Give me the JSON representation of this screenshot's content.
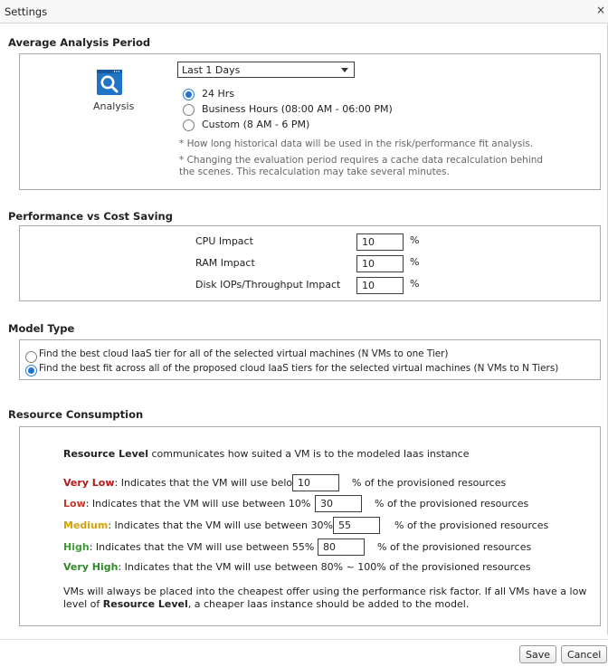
{
  "window": {
    "title": "Settings",
    "close_glyph": "×"
  },
  "average_analysis_period": {
    "title": "Average Analysis Period",
    "icon_label": "Analysis",
    "period_select": {
      "value": "Last 1 Days"
    },
    "radio_options": [
      {
        "label": "24 Hrs",
        "selected": true
      },
      {
        "label": "Business Hours (08:00 AM - 06:00 PM)",
        "selected": false
      },
      {
        "label": "Custom (8 AM - 6 PM)",
        "selected": false
      }
    ],
    "note1": "* How long historical data will be used in the risk/performance fit analysis.",
    "note2_line1": "* Changing the evaluation period requires a cache data recalculation behind",
    "note2_line2": "the scenes. This recalculation may take several minutes."
  },
  "performance_vs_cost": {
    "title": "Performance vs Cost Saving",
    "fields": [
      {
        "label": "CPU Impact",
        "value": "10",
        "unit": "%"
      },
      {
        "label": "RAM Impact",
        "value": "10",
        "unit": "%"
      },
      {
        "label": "Disk IOPs/Throughput Impact",
        "value": "10",
        "unit": "%"
      }
    ]
  },
  "model_type": {
    "title": "Model Type",
    "options": [
      {
        "label": "Find the best cloud IaaS tier for all of the selected virtual machines (N VMs to one Tier)",
        "selected": false
      },
      {
        "label": "Find the best fit across all of the proposed cloud IaaS tiers for the selected virtual machines (N VMs to N Tiers)",
        "selected": true
      }
    ]
  },
  "resource_consumption": {
    "title": "Resource Consumption",
    "intro_bold": "Resource Level",
    "intro_rest": " communicates how suited a VM is to the modeled Iaas instance",
    "levels": {
      "very_low": {
        "name": "Very Low",
        "text": ": Indicates that the VM will use below",
        "value": "10",
        "suffix": "% of the provisioned resources",
        "color": "#b01b1b"
      },
      "low": {
        "name": "Low",
        "text": ": Indicates that the VM will use between 10% ~",
        "value": "30",
        "suffix": "% of the provisioned resources",
        "color": "#c0392b"
      },
      "medium": {
        "name": "Medium",
        "text": ": Indicates that the VM will use between 30% ~",
        "value": "55",
        "suffix": "% of the provisioned resources",
        "color": "#d4a20a"
      },
      "high": {
        "name": "High",
        "text": ": Indicates that the VM will use between 55% ~",
        "value": "80",
        "suffix": "% of the provisioned resources",
        "color": "#3f9b36"
      },
      "very_high": {
        "name": "Very High",
        "text": ": Indicates that the VM will use between 80% ~ 100% of the provisioned resources",
        "color": "#2f8a2a"
      }
    },
    "footer_line1": "VMs will always be placed into the cheapest offer using the performance risk factor. If all VMs have a low",
    "footer_line2_pre": "level of ",
    "footer_line2_bold": "Resource Level",
    "footer_line2_post": ", a cheaper Iaas instance should be added to the model."
  },
  "buttons": {
    "save": "Save",
    "cancel": "Cancel"
  }
}
